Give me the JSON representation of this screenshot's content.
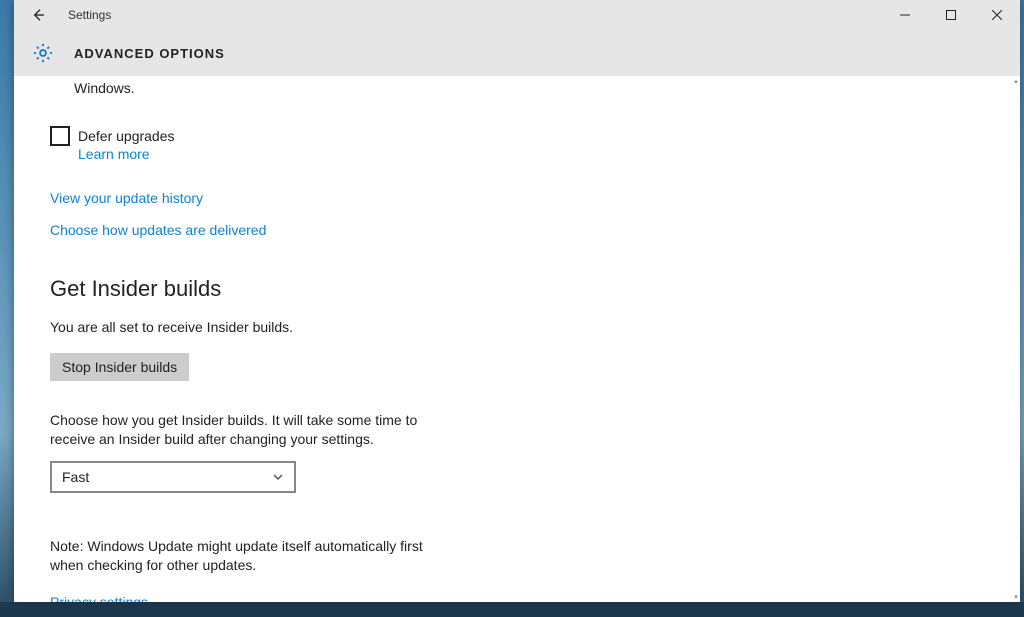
{
  "titlebar": {
    "app_name": "Settings"
  },
  "header": {
    "title": "ADVANCED OPTIONS"
  },
  "content": {
    "truncated_sentence_tail": "Windows.",
    "defer": {
      "label": "Defer upgrades",
      "learn_more": "Learn more"
    },
    "links": {
      "history": "View your update history",
      "delivery": "Choose how updates are delivered"
    },
    "insider": {
      "heading": "Get Insider builds",
      "status": "You are all set to receive Insider builds.",
      "stop_button": "Stop Insider builds",
      "choose_text": "Choose how you get Insider builds. It will take some time to receive an Insider build after changing your settings.",
      "ring_selected": "Fast"
    },
    "note": "Note: Windows Update might update itself automatically first when checking for other updates.",
    "privacy_link": "Privacy settings"
  }
}
